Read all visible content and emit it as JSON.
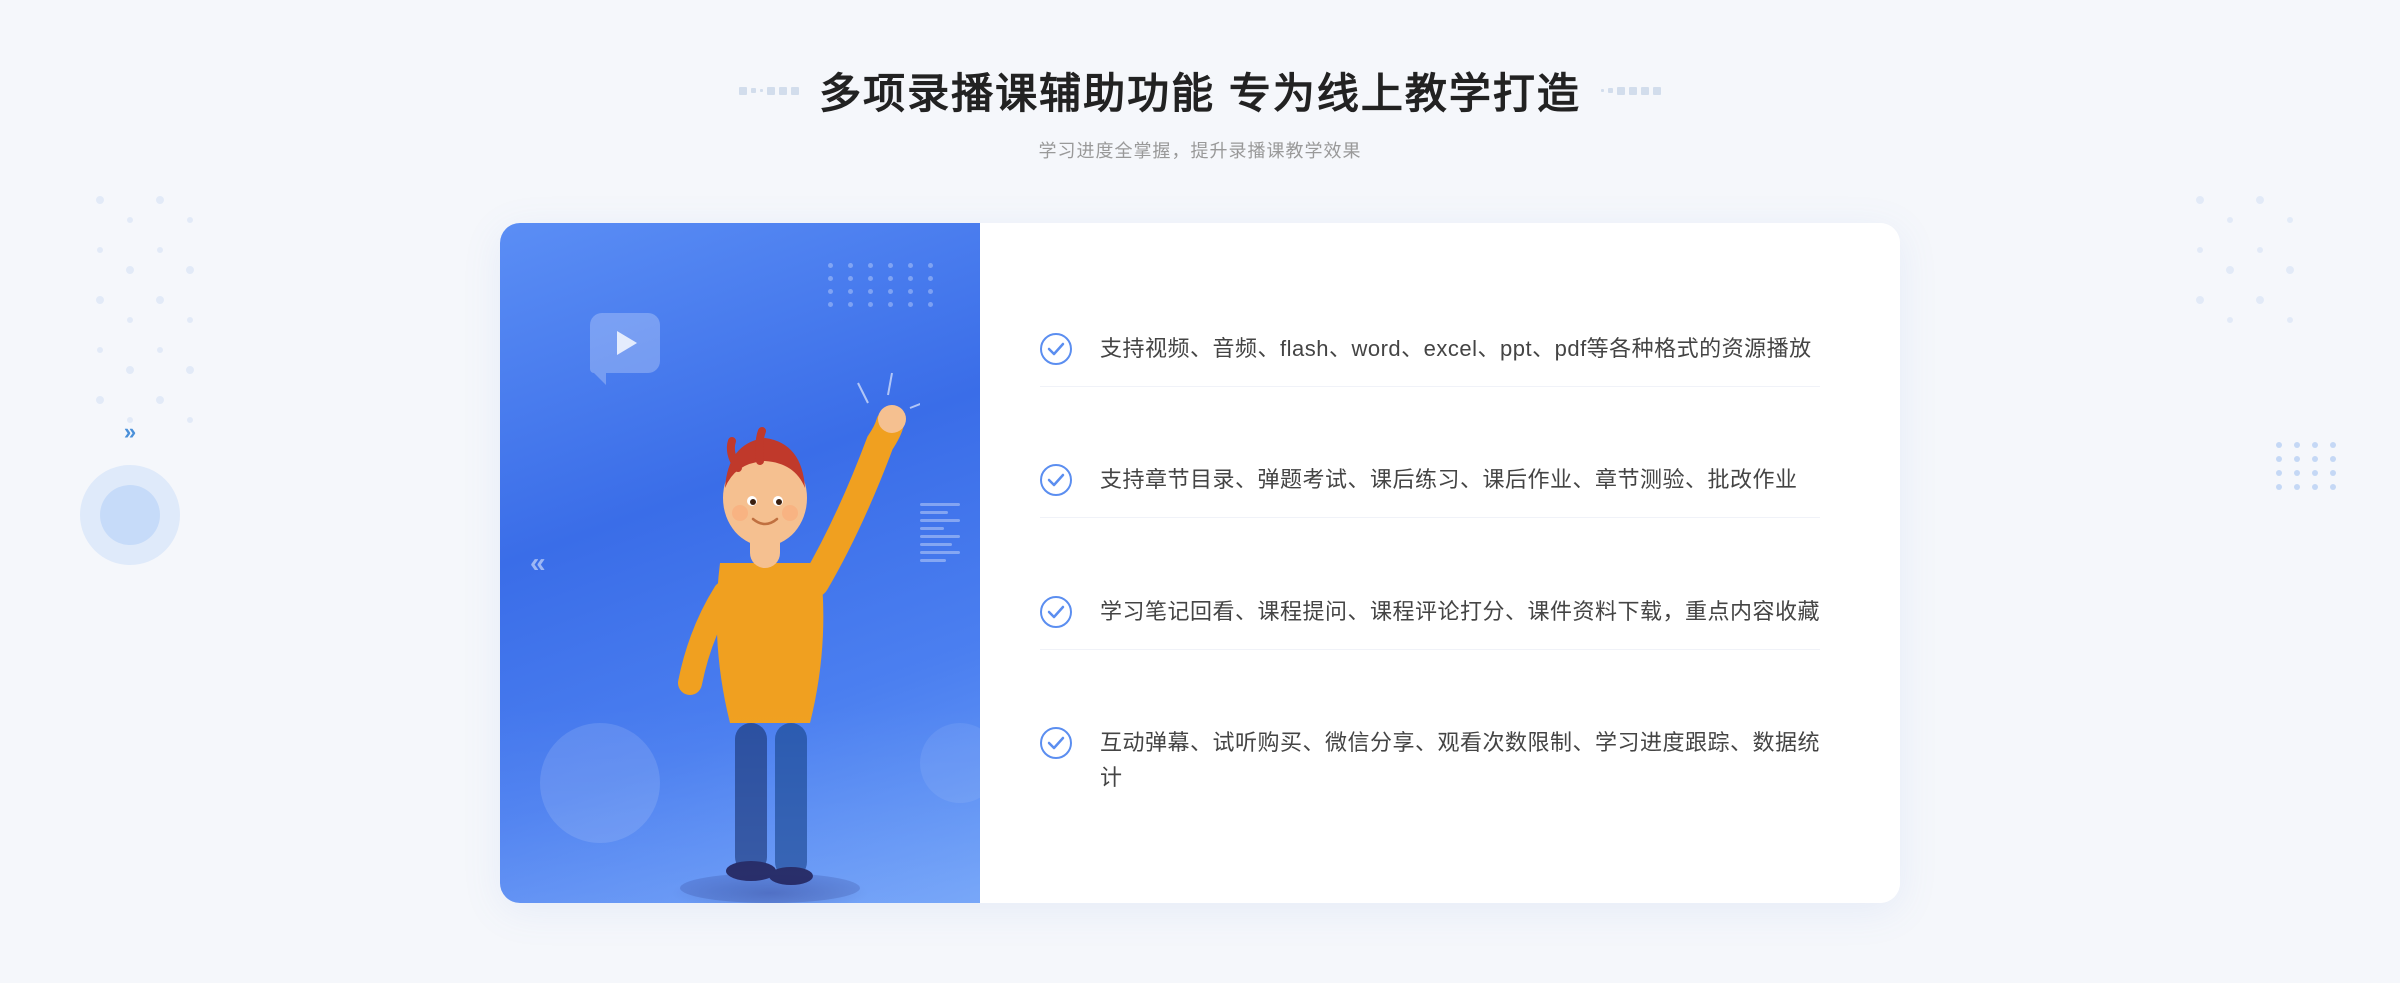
{
  "header": {
    "title": "多项录播课辅助功能 专为线上教学打造",
    "subtitle": "学习进度全掌握，提升录播课教学效果"
  },
  "features": [
    {
      "id": "feature-1",
      "text": "支持视频、音频、flash、word、excel、ppt、pdf等各种格式的资源播放"
    },
    {
      "id": "feature-2",
      "text": "支持章节目录、弹题考试、课后练习、课后作业、章节测验、批改作业"
    },
    {
      "id": "feature-3",
      "text": "学习笔记回看、课程提问、课程评论打分、课件资料下载，重点内容收藏"
    },
    {
      "id": "feature-4",
      "text": "互动弹幕、试听购买、微信分享、观看次数限制、学习进度跟踪、数据统计"
    }
  ],
  "colors": {
    "accent": "#4a7ef5",
    "check": "#5b8ef0",
    "text_main": "#333333",
    "text_sub": "#999999"
  },
  "icons": {
    "check_circle": "✓",
    "chevron": "»"
  }
}
